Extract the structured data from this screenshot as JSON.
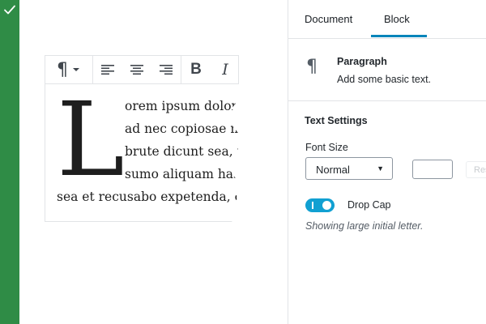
{
  "status": {
    "icon": "checkmark-icon",
    "color": "#2f8c46"
  },
  "toolbar": {
    "paragraph_icon": "¶",
    "bold_label": "B",
    "italic_label": "I"
  },
  "block": {
    "drop_cap": "L",
    "lines": [
      "orem ipsum dolor s",
      "ad nec copiosae m",
      "brute dicunt sea, u",
      "sumo aliquam has,",
      "sea et recusabo expetenda, or"
    ]
  },
  "sidebar": {
    "tabs": [
      {
        "label": "Document"
      },
      {
        "label": "Block"
      }
    ],
    "active_tab": "Block",
    "accent_color": "#0085ba",
    "block_card": {
      "icon": "¶",
      "title": "Paragraph",
      "description": "Add some basic text."
    },
    "text_settings": {
      "title": "Text Settings",
      "font_size_label": "Font Size",
      "font_size_value": "Normal",
      "custom_value": "",
      "reset_label": "Res",
      "drop_cap_label": "Drop Cap",
      "drop_cap_enabled": true,
      "help_text": "Showing large initial letter."
    }
  }
}
